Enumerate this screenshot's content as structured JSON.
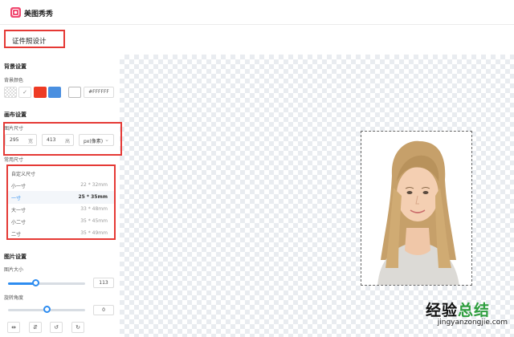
{
  "app": {
    "brand": "美图秀秀"
  },
  "page": {
    "title": "证件照设计"
  },
  "background": {
    "section": "背景设置",
    "color_label": "背景颜色",
    "swatches": [
      "transparent",
      "#ffffff",
      "#ee3b24",
      "#4a8fe0"
    ],
    "hex_value": "#FFFFFF"
  },
  "canvas_settings": {
    "section": "画布设置",
    "size_label": "图片尺寸",
    "width": "295",
    "height": "413",
    "width_unit": "宽",
    "height_unit": "高",
    "unit": "px(像素)"
  },
  "presets": {
    "label": "常用尺寸",
    "items": [
      {
        "name": "自定义尺寸",
        "dims": ""
      },
      {
        "name": "小一寸",
        "dims": "22 * 32mm"
      },
      {
        "name": "一寸",
        "dims": "25 * 35mm",
        "active": true
      },
      {
        "name": "大一寸",
        "dims": "33 * 48mm"
      },
      {
        "name": "小二寸",
        "dims": "35 * 45mm"
      },
      {
        "name": "二寸",
        "dims": "35 * 49mm"
      }
    ]
  },
  "image_settings": {
    "section": "图片设置",
    "size_label": "图片大小",
    "size_value": "113",
    "size_fraction": 0.36,
    "rotate_label": "旋转角度",
    "rotate_value": "0",
    "rotate_fraction": 0.5
  },
  "toolbar": {
    "icons": [
      "flip-horizontal-icon",
      "flip-vertical-icon",
      "rotate-left-icon",
      "rotate-right-icon"
    ]
  },
  "watermark": {
    "text_black": "经验",
    "text_green": "总结",
    "url": "jingyanzongjie.com"
  },
  "colors": {
    "accent": "#2d8cf0",
    "highlight": "#e53935",
    "brand": "#f0466e"
  }
}
